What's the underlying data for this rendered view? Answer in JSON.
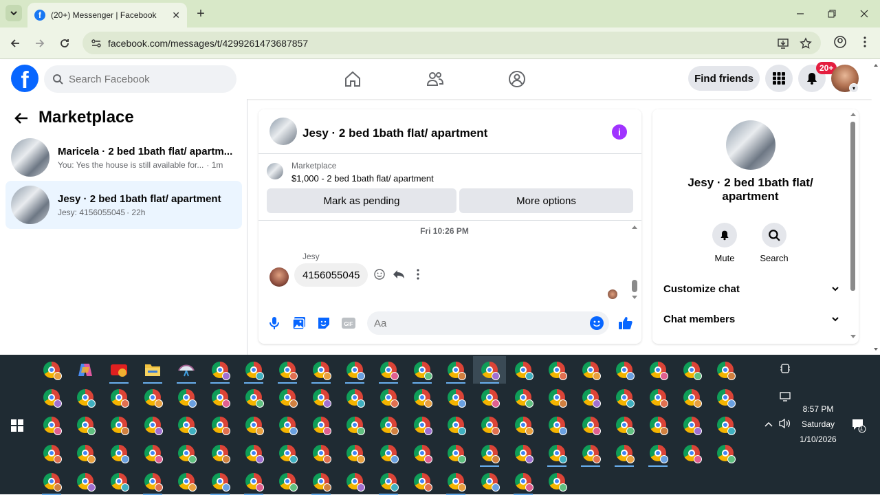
{
  "browser": {
    "tab_title": "(20+) Messenger | Facebook",
    "url": "facebook.com/messages/t/4299261473687857"
  },
  "fb_header": {
    "search_placeholder": "Search Facebook",
    "find_friends_label": "Find friends",
    "notification_badge": "20+"
  },
  "left_panel": {
    "title": "Marketplace",
    "conversations": [
      {
        "name": "Maricela · 2 bed 1bath flat/ apartm...",
        "snippet": "You: Yes the house is still available for...",
        "time": "· 1m",
        "active": false
      },
      {
        "name": "Jesy · 2 bed 1bath flat/ apartment",
        "snippet": "Jesy: 4156055045",
        "time": "· 22h",
        "active": true
      }
    ]
  },
  "chat": {
    "title": "Jesy · 2 bed 1bath flat/ apartment",
    "marketplace_label": "Marketplace",
    "listing": "$1,000 - 2 bed 1bath flat/ apartment",
    "mark_pending_label": "Mark as pending",
    "more_options_label": "More options",
    "timestamp": "Fri 10:26 PM",
    "sender": "Jesy",
    "message": "4156055045",
    "composer_placeholder": "Aa"
  },
  "right_panel": {
    "name": "Jesy · 2 bed 1bath flat/ apartment",
    "mute_label": "Mute",
    "search_label": "Search",
    "customize_label": "Customize chat",
    "members_label": "Chat members"
  },
  "taskbar": {
    "time": "8:57 PM",
    "day": "Saturday",
    "date": "1/10/2026",
    "notification_count": "1"
  },
  "colors": {
    "fb_blue": "#0866ff",
    "active_conv_bg": "#ebf5ff",
    "accent_purple": "#a033ff",
    "browser_frame": "#d8e8c8"
  }
}
